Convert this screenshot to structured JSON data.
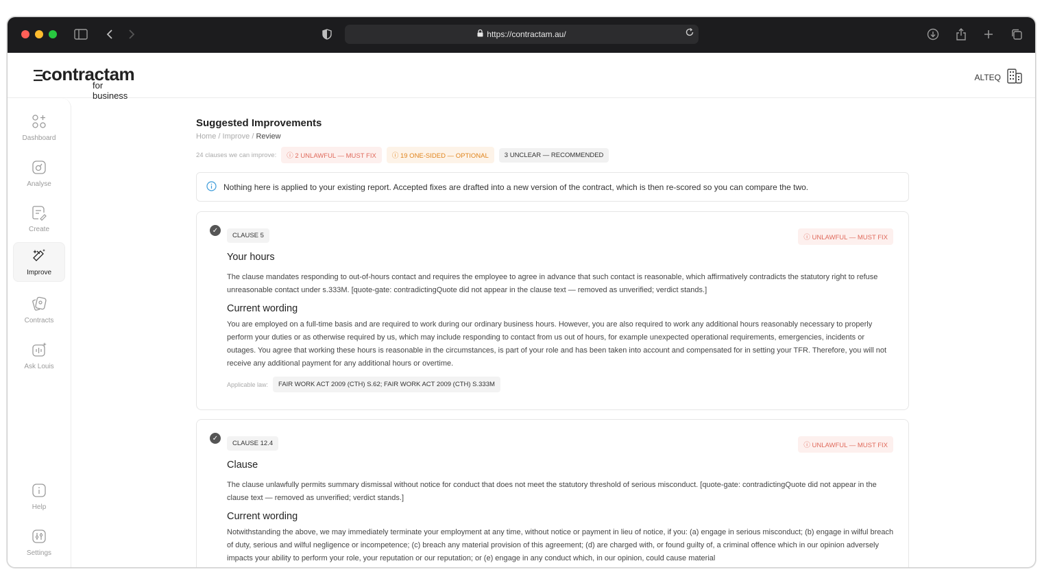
{
  "browser": {
    "url": "https://contractam.au/"
  },
  "app": {
    "logo_main": "contractam",
    "logo_sub": "for business",
    "org_name": "ALTEQ"
  },
  "sidebar": {
    "items": [
      {
        "label": "Dashboard",
        "icon": "dashboard-icon"
      },
      {
        "label": "Analyse",
        "icon": "analyse-icon"
      },
      {
        "label": "Create",
        "icon": "create-icon"
      },
      {
        "label": "Improve",
        "icon": "improve-icon",
        "active": true
      },
      {
        "label": "Contracts",
        "icon": "contracts-icon"
      },
      {
        "label": "Ask Louis",
        "icon": "ask-louis-icon"
      }
    ],
    "bottom": [
      {
        "label": "Help",
        "icon": "help-icon"
      },
      {
        "label": "Settings",
        "icon": "settings-icon"
      }
    ]
  },
  "page": {
    "title": "Suggested Improvements",
    "breadcrumb": [
      "Home",
      "Improve",
      "Review"
    ],
    "summary_label": "24 clauses we can improve:",
    "chips": {
      "unlawful": "2 UNLAWFUL — MUST FIX",
      "onesided": "19 ONE-SIDED — OPTIONAL",
      "unclear": "3 UNCLEAR — RECOMMENDED"
    },
    "info_text": "Nothing here is applied to your existing report. Accepted fixes are drafted into a new version of the contract, which is then re-scored so you can compare the two."
  },
  "cards": [
    {
      "clause": "CLAUSE 5",
      "status": "UNLAWFUL — MUST FIX",
      "title": "Your hours",
      "description": "The clause mandates responding to out-of-hours contact and requires the employee to agree in advance that such contact is reasonable, which affirmatively contradicts the statutory right to refuse unreasonable contact under s.333M. [quote-gate: contradictingQuote did not appear in the clause text — removed as unverified; verdict stands.]",
      "wording_heading": "Current wording",
      "wording": "You are employed on a full-time basis and are required to work during our ordinary business hours. However, you are also required to work any additional hours reasonably necessary to properly perform your duties or as otherwise required by us, which may include responding to contact from us out of hours, for example unexpected operational requirements, emergencies, incidents or outages. You agree that working these hours is reasonable in the circumstances, is part of your role and has been taken into account and compensated for in setting your TFR. Therefore, you will not receive any additional payment for any additional hours or overtime.",
      "applicable_label": "Applicable law:",
      "law": "FAIR WORK ACT 2009 (CTH) S.62; FAIR WORK ACT 2009 (CTH) S.333M"
    },
    {
      "clause": "CLAUSE 12.4",
      "status": "UNLAWFUL — MUST FIX",
      "title": "Clause",
      "description": "The clause unlawfully permits summary dismissal without notice for conduct that does not meet the statutory threshold of serious misconduct. [quote-gate: contradictingQuote did not appear in the clause text — removed as unverified; verdict stands.]",
      "wording_heading": "Current wording",
      "wording": "Notwithstanding the above, we may immediately terminate your employment at any time, without notice or payment in lieu of notice, if you: (a) engage in serious misconduct; (b) engage in wilful breach of duty, serious and wilful negligence or incompetence; (c) breach any material provision of this agreement; (d) are charged with, or found guilty of, a criminal offence which in our opinion adversely impacts your ability to perform your role, your reputation or our reputation; or (e) engage in any conduct which, in our opinion, could cause material"
    }
  ]
}
